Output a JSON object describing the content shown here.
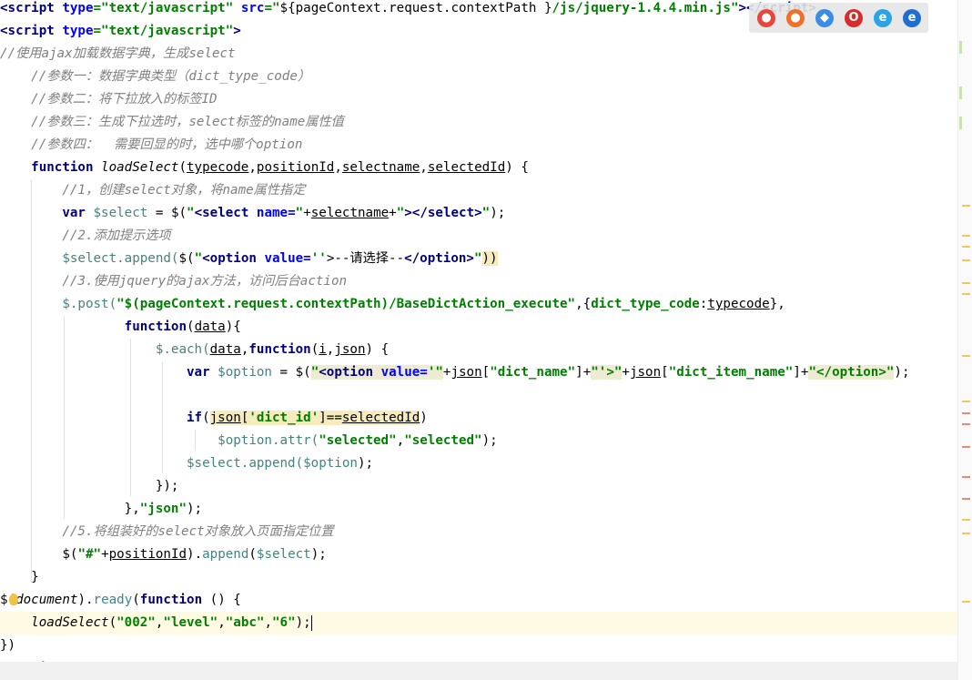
{
  "editor": {
    "lines": [
      {
        "tokens": [
          {
            "t": "<",
            "c": "tag"
          },
          {
            "t": "script",
            "c": "tag"
          },
          {
            "t": " ",
            "c": "plain"
          },
          {
            "t": "type",
            "c": "attr"
          },
          {
            "t": "=\"text/javascript\"",
            "c": "str"
          },
          {
            "t": " ",
            "c": "plain"
          },
          {
            "t": "src",
            "c": "attr"
          },
          {
            "t": "=\"",
            "c": "str"
          },
          {
            "t": "${",
            "c": "plain"
          },
          {
            "t": "pageContext.request.contextPath",
            "c": "plain"
          },
          {
            "t": " }",
            "c": "plain"
          },
          {
            "t": "/js/jquery-1.4.4.min.js\"",
            "c": "str"
          },
          {
            "t": "></",
            "c": "tag"
          },
          {
            "t": "script",
            "c": "tag"
          },
          {
            "t": ">",
            "c": "tag"
          }
        ]
      },
      {
        "tokens": [
          {
            "t": "<script ",
            "c": "tag"
          },
          {
            "t": "type",
            "c": "attr"
          },
          {
            "t": "=\"text/javascript\"",
            "c": "str"
          },
          {
            "t": ">",
            "c": "tag"
          }
        ]
      },
      {
        "tokens": [
          {
            "t": "//使用ajax加载数据字典，生成select",
            "c": "cmt"
          }
        ]
      },
      {
        "tokens": [
          {
            "t": "    //参数一：数据字典类型（dict_type_code）",
            "c": "cmt"
          }
        ]
      },
      {
        "tokens": [
          {
            "t": "    //参数二：将下拉放入的标签ID",
            "c": "cmt"
          }
        ]
      },
      {
        "tokens": [
          {
            "t": "    //参数三：生成下拉选时，select标签的name属性值",
            "c": "cmt"
          }
        ]
      },
      {
        "tokens": [
          {
            "t": "    //参数四：  需要回显的时，选中哪个option",
            "c": "cmt"
          }
        ]
      },
      {
        "tokens": [
          {
            "t": "    ",
            "c": "plain"
          },
          {
            "t": "function ",
            "c": "kw"
          },
          {
            "t": "loadSelect",
            "c": "fn"
          },
          {
            "t": "(",
            "c": "plain"
          },
          {
            "t": "typecode",
            "c": "plain u"
          },
          {
            "t": ",",
            "c": "plain"
          },
          {
            "t": "positionId",
            "c": "plain u"
          },
          {
            "t": ",",
            "c": "plain"
          },
          {
            "t": "selectname",
            "c": "plain u"
          },
          {
            "t": ",",
            "c": "plain"
          },
          {
            "t": "selectedId",
            "c": "plain u"
          },
          {
            "t": ") {",
            "c": "plain"
          }
        ]
      },
      {
        "tokens": [
          {
            "t": "        //1，创建select对象，将name属性指定",
            "c": "cmt"
          }
        ]
      },
      {
        "tokens": [
          {
            "t": "        ",
            "c": "plain"
          },
          {
            "t": "var ",
            "c": "kw"
          },
          {
            "t": "$select",
            "c": "var"
          },
          {
            "t": " = ",
            "c": "plain"
          },
          {
            "t": "$",
            "c": "plain"
          },
          {
            "t": "(",
            "c": "plain"
          },
          {
            "t": "\"",
            "c": "str"
          },
          {
            "t": "<select ",
            "c": "tag"
          },
          {
            "t": "name=",
            "c": "attr"
          },
          {
            "t": "\"",
            "c": "str"
          },
          {
            "t": "+",
            "c": "plain"
          },
          {
            "t": "selectname",
            "c": "plain u"
          },
          {
            "t": "+",
            "c": "plain"
          },
          {
            "t": "\"",
            "c": "str"
          },
          {
            "t": "></select>",
            "c": "tag"
          },
          {
            "t": "\"",
            "c": "str"
          },
          {
            "t": ");",
            "c": "plain"
          }
        ]
      },
      {
        "tokens": [
          {
            "t": "        //2.添加提示选项",
            "c": "cmt"
          }
        ]
      },
      {
        "tokens": [
          {
            "t": "        ",
            "c": "plain"
          },
          {
            "t": "$select",
            "c": "var"
          },
          {
            "t": ".append(",
            "c": "var"
          },
          {
            "t": "$",
            "c": "plain"
          },
          {
            "t": "(",
            "c": "plain"
          },
          {
            "t": "\"",
            "c": "str"
          },
          {
            "t": "<option ",
            "c": "tag"
          },
          {
            "t": "value=",
            "c": "attr"
          },
          {
            "t": "''",
            "c": "str"
          },
          {
            "t": ">--请选择--",
            "c": "plain"
          },
          {
            "t": "</option>",
            "c": "tag"
          },
          {
            "t": "\"",
            "c": "str"
          },
          {
            "t": "))",
            "c": "plain hl"
          }
        ]
      },
      {
        "tokens": [
          {
            "t": "        //3.使用jquery的ajax方法，访问后台action",
            "c": "cmt"
          }
        ]
      },
      {
        "tokens": [
          {
            "t": "        ",
            "c": "plain"
          },
          {
            "t": "$",
            "c": "var"
          },
          {
            "t": ".post(",
            "c": "var"
          },
          {
            "t": "\"$(pageContext.request.contextPath)/BaseDictAction_execute\"",
            "c": "str"
          },
          {
            "t": ",{",
            "c": "plain"
          },
          {
            "t": "dict_type_code",
            "c": "str"
          },
          {
            "t": ":",
            "c": "plain"
          },
          {
            "t": "typecode",
            "c": "plain u"
          },
          {
            "t": "},",
            "c": "plain"
          }
        ]
      },
      {
        "tokens": [
          {
            "t": "                ",
            "c": "plain"
          },
          {
            "t": "function",
            "c": "kw"
          },
          {
            "t": "(",
            "c": "plain"
          },
          {
            "t": "data",
            "c": "plain u"
          },
          {
            "t": "){",
            "c": "plain"
          }
        ]
      },
      {
        "tokens": [
          {
            "t": "                    ",
            "c": "plain"
          },
          {
            "t": "$",
            "c": "var"
          },
          {
            "t": ".each(",
            "c": "var"
          },
          {
            "t": "data",
            "c": "plain u"
          },
          {
            "t": ",",
            "c": "plain"
          },
          {
            "t": "function",
            "c": "kw"
          },
          {
            "t": "(",
            "c": "plain"
          },
          {
            "t": "i",
            "c": "plain u"
          },
          {
            "t": ",",
            "c": "plain"
          },
          {
            "t": "json",
            "c": "plain u"
          },
          {
            "t": ") {",
            "c": "plain"
          }
        ]
      },
      {
        "tokens": [
          {
            "t": "                        ",
            "c": "plain"
          },
          {
            "t": "var ",
            "c": "kw"
          },
          {
            "t": "$option",
            "c": "var"
          },
          {
            "t": " = ",
            "c": "plain"
          },
          {
            "t": "$",
            "c": "plain"
          },
          {
            "t": "(",
            "c": "plain"
          },
          {
            "t": "\"",
            "c": "str hl2"
          },
          {
            "t": "<option ",
            "c": "tag hl2"
          },
          {
            "t": "value=",
            "c": "attr hl2"
          },
          {
            "t": "'\"",
            "c": "str hl2"
          },
          {
            "t": "+",
            "c": "plain"
          },
          {
            "t": "json",
            "c": "plain u"
          },
          {
            "t": "[",
            "c": "plain"
          },
          {
            "t": "\"dict_name\"",
            "c": "str"
          },
          {
            "t": "]+",
            "c": "plain"
          },
          {
            "t": "\"'>\"",
            "c": "str hl2"
          },
          {
            "t": "+",
            "c": "plain"
          },
          {
            "t": "json",
            "c": "plain u"
          },
          {
            "t": "[",
            "c": "plain"
          },
          {
            "t": "\"dict_item_name\"",
            "c": "str"
          },
          {
            "t": "]+",
            "c": "plain"
          },
          {
            "t": "\"</option>\"",
            "c": "str hl2"
          },
          {
            "t": ");",
            "c": "plain"
          }
        ]
      },
      {
        "tokens": [
          {
            "t": "",
            "c": "plain"
          }
        ]
      },
      {
        "tokens": [
          {
            "t": "                        ",
            "c": "plain"
          },
          {
            "t": "if",
            "c": "kw"
          },
          {
            "t": "(",
            "c": "plain"
          },
          {
            "t": "json",
            "c": "plain u hl"
          },
          {
            "t": "[",
            "c": "plain hl"
          },
          {
            "t": "'dict_id'",
            "c": "str hl"
          },
          {
            "t": "]==",
            "c": "plain hl"
          },
          {
            "t": "selectedId",
            "c": "plain u hl"
          },
          {
            "t": ")",
            "c": "plain"
          }
        ]
      },
      {
        "tokens": [
          {
            "t": "                            ",
            "c": "plain"
          },
          {
            "t": "$option",
            "c": "var"
          },
          {
            "t": ".attr(",
            "c": "var"
          },
          {
            "t": "\"selected\"",
            "c": "str"
          },
          {
            "t": ",",
            "c": "plain"
          },
          {
            "t": "\"selected\"",
            "c": "str"
          },
          {
            "t": ");",
            "c": "plain"
          }
        ]
      },
      {
        "tokens": [
          {
            "t": "                        ",
            "c": "plain"
          },
          {
            "t": "$select",
            "c": "var"
          },
          {
            "t": ".append(",
            "c": "var"
          },
          {
            "t": "$option",
            "c": "var"
          },
          {
            "t": ");",
            "c": "plain"
          }
        ]
      },
      {
        "tokens": [
          {
            "t": "                    });",
            "c": "plain"
          }
        ]
      },
      {
        "tokens": [
          {
            "t": "                },",
            "c": "plain"
          },
          {
            "t": "\"json\"",
            "c": "str"
          },
          {
            "t": ");",
            "c": "plain"
          }
        ]
      },
      {
        "tokens": [
          {
            "t": "        //5.将组装好的select对象放入页面指定位置",
            "c": "cmt"
          }
        ]
      },
      {
        "tokens": [
          {
            "t": "        ",
            "c": "plain"
          },
          {
            "t": "$",
            "c": "plain"
          },
          {
            "t": "(",
            "c": "plain"
          },
          {
            "t": "\"#\"",
            "c": "str"
          },
          {
            "t": "+",
            "c": "plain"
          },
          {
            "t": "positionId",
            "c": "plain u"
          },
          {
            "t": ").",
            "c": "plain"
          },
          {
            "t": "append",
            "c": "var"
          },
          {
            "t": "(",
            "c": "plain"
          },
          {
            "t": "$select",
            "c": "var"
          },
          {
            "t": ");",
            "c": "plain"
          }
        ]
      },
      {
        "tokens": [
          {
            "t": "    }",
            "c": "plain"
          }
        ]
      },
      {
        "tokens": [
          {
            "t": "$(",
            "c": "plain"
          },
          {
            "t": "document",
            "c": "fn"
          },
          {
            "t": ").",
            "c": "plain"
          },
          {
            "t": "ready",
            "c": "var"
          },
          {
            "t": "(",
            "c": "plain"
          },
          {
            "t": "function ",
            "c": "kw"
          },
          {
            "t": "() {",
            "c": "plain"
          }
        ]
      },
      {
        "tokens": [
          {
            "t": "    ",
            "c": "plain"
          },
          {
            "t": "loadSelect",
            "c": "fn"
          },
          {
            "t": "(",
            "c": "plain"
          },
          {
            "t": "\"002\"",
            "c": "str"
          },
          {
            "t": ",",
            "c": "plain"
          },
          {
            "t": "\"level\"",
            "c": "str"
          },
          {
            "t": ",",
            "c": "plain"
          },
          {
            "t": "\"abc\"",
            "c": "str"
          },
          {
            "t": ",",
            "c": "plain"
          },
          {
            "t": "\"6\"",
            "c": "str"
          },
          {
            "t": ");",
            "c": "plain"
          }
        ]
      },
      {
        "tokens": [
          {
            "t": "})",
            "c": "plain"
          }
        ]
      },
      {
        "tokens": [
          {
            "t": "</",
            "c": "tag"
          },
          {
            "t": "script",
            "c": "tag"
          },
          {
            "t": ">",
            "c": "tag"
          }
        ]
      }
    ],
    "current_line_index": 27
  },
  "browser_icons": [
    {
      "name": "chrome-icon",
      "glyph": "●",
      "color": "#e8453c"
    },
    {
      "name": "firefox-icon",
      "glyph": "●",
      "color": "#f0702a"
    },
    {
      "name": "safari-icon",
      "glyph": "◆",
      "color": "#3b8be8"
    },
    {
      "name": "opera-icon",
      "glyph": "O",
      "color": "#d92b2b"
    },
    {
      "name": "ie-icon",
      "glyph": "e",
      "color": "#2aa3e8"
    },
    {
      "name": "edge-icon",
      "glyph": "e",
      "color": "#1e6fd1"
    }
  ],
  "gutter_marks": [
    {
      "kind": "g"
    },
    {
      "kind": "g"
    },
    {
      "kind": "g"
    },
    {
      "kind": "y"
    },
    {
      "kind": "y"
    },
    {
      "kind": "y"
    },
    {
      "kind": "y"
    },
    {
      "kind": "y"
    },
    {
      "kind": "y"
    },
    {
      "kind": "y"
    },
    {
      "kind": "y"
    },
    {
      "kind": "r"
    },
    {
      "kind": "r"
    },
    {
      "kind": "r"
    },
    {
      "kind": "r"
    },
    {
      "kind": "r"
    },
    {
      "kind": "y"
    },
    {
      "kind": "y"
    },
    {
      "kind": "y"
    }
  ]
}
